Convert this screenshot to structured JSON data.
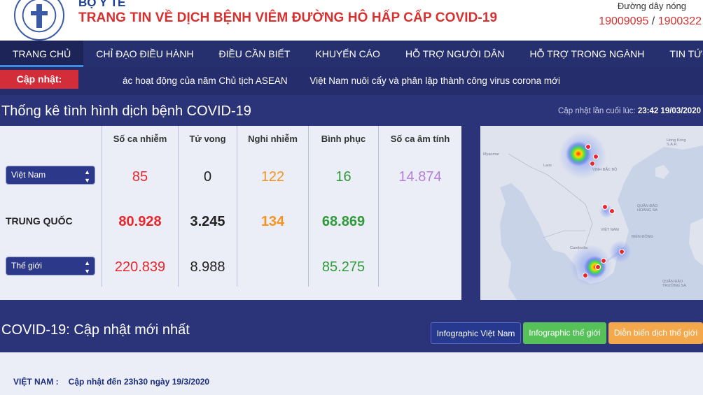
{
  "header": {
    "ministry": "BỘ Y TẾ",
    "title": "TRANG TIN VỀ DỊCH BỆNH VIÊM ĐƯỜNG HÔ HẤP CẤP COVID-19",
    "hotline_label": "Đường dây nóng",
    "hotline_1": "19009095",
    "hotline_sep": " / ",
    "hotline_2": "1900322"
  },
  "nav": {
    "items": [
      "TRANG CHỦ",
      "CHỈ ĐẠO ĐIỀU HÀNH",
      "ĐIỀU CẦN BIẾT",
      "KHUYẾN CÁO",
      "HỖ TRỢ NGƯỜI DÂN",
      "HỖ TRỢ TRONG NGÀNH",
      "TIN TỨC"
    ],
    "active": "TRANG CHỦ"
  },
  "ticker": {
    "label": "Cập nhật:",
    "items": [
      "ác hoạt động của năm Chủ tịch ASEAN",
      "Việt Nam nuôi cấy và phân lập thành công virus corona mới"
    ]
  },
  "stats": {
    "title": "Thống kê tình hình dịch bệnh COVID-19",
    "last_update_label": "Cập nhật lần cuối lúc: ",
    "last_update_value": "23:42 19/03/2020",
    "columns": [
      "Số ca nhiễm",
      "Tử vong",
      "Nghi nhiễm",
      "Bình phục",
      "Số ca âm tính"
    ],
    "rows": [
      {
        "label": "Việt Nam",
        "kind": "select",
        "values": [
          "85",
          "0",
          "122",
          "16",
          "14.874"
        ]
      },
      {
        "label": "TRUNG QUỐC",
        "kind": "text",
        "values": [
          "80.928",
          "3.245",
          "134",
          "68.869",
          ""
        ]
      },
      {
        "label": "Thế giới",
        "kind": "select",
        "values": [
          "220.839",
          "8.988",
          "",
          "85.275",
          ""
        ]
      }
    ]
  },
  "map": {
    "labels": [
      "Myanmar",
      "Laos",
      "VỊNH BẮC BỘ",
      "Hong Kong S.A.R.",
      "QUẦN ĐẢO HOÀNG SA",
      "VIỆT NAM",
      "BIỂN ĐÔNG",
      "Cambodia",
      "QUẦN ĐẢO TRƯỜNG SA"
    ]
  },
  "latest": {
    "title": "COVID-19: Cập nhật mới nhất",
    "buttons": [
      "Infographic Việt Nam",
      "Infographic thế giới",
      "Diễn biến dịch thế giới"
    ],
    "vn_label": "VIỆT NAM :",
    "vn_text": "Cập nhật đến 23h30 ngày 19/3/2020"
  },
  "colors": {
    "background": "#2b3478",
    "title_red": "#d63031",
    "infected": "#e8262b",
    "suspected": "#f5941f",
    "recovered": "#2e9a38",
    "negative": "#b57fd9",
    "btn_vn": "#27398f",
    "btn_world": "#56c059",
    "btn_timeline": "#f3a84b"
  }
}
